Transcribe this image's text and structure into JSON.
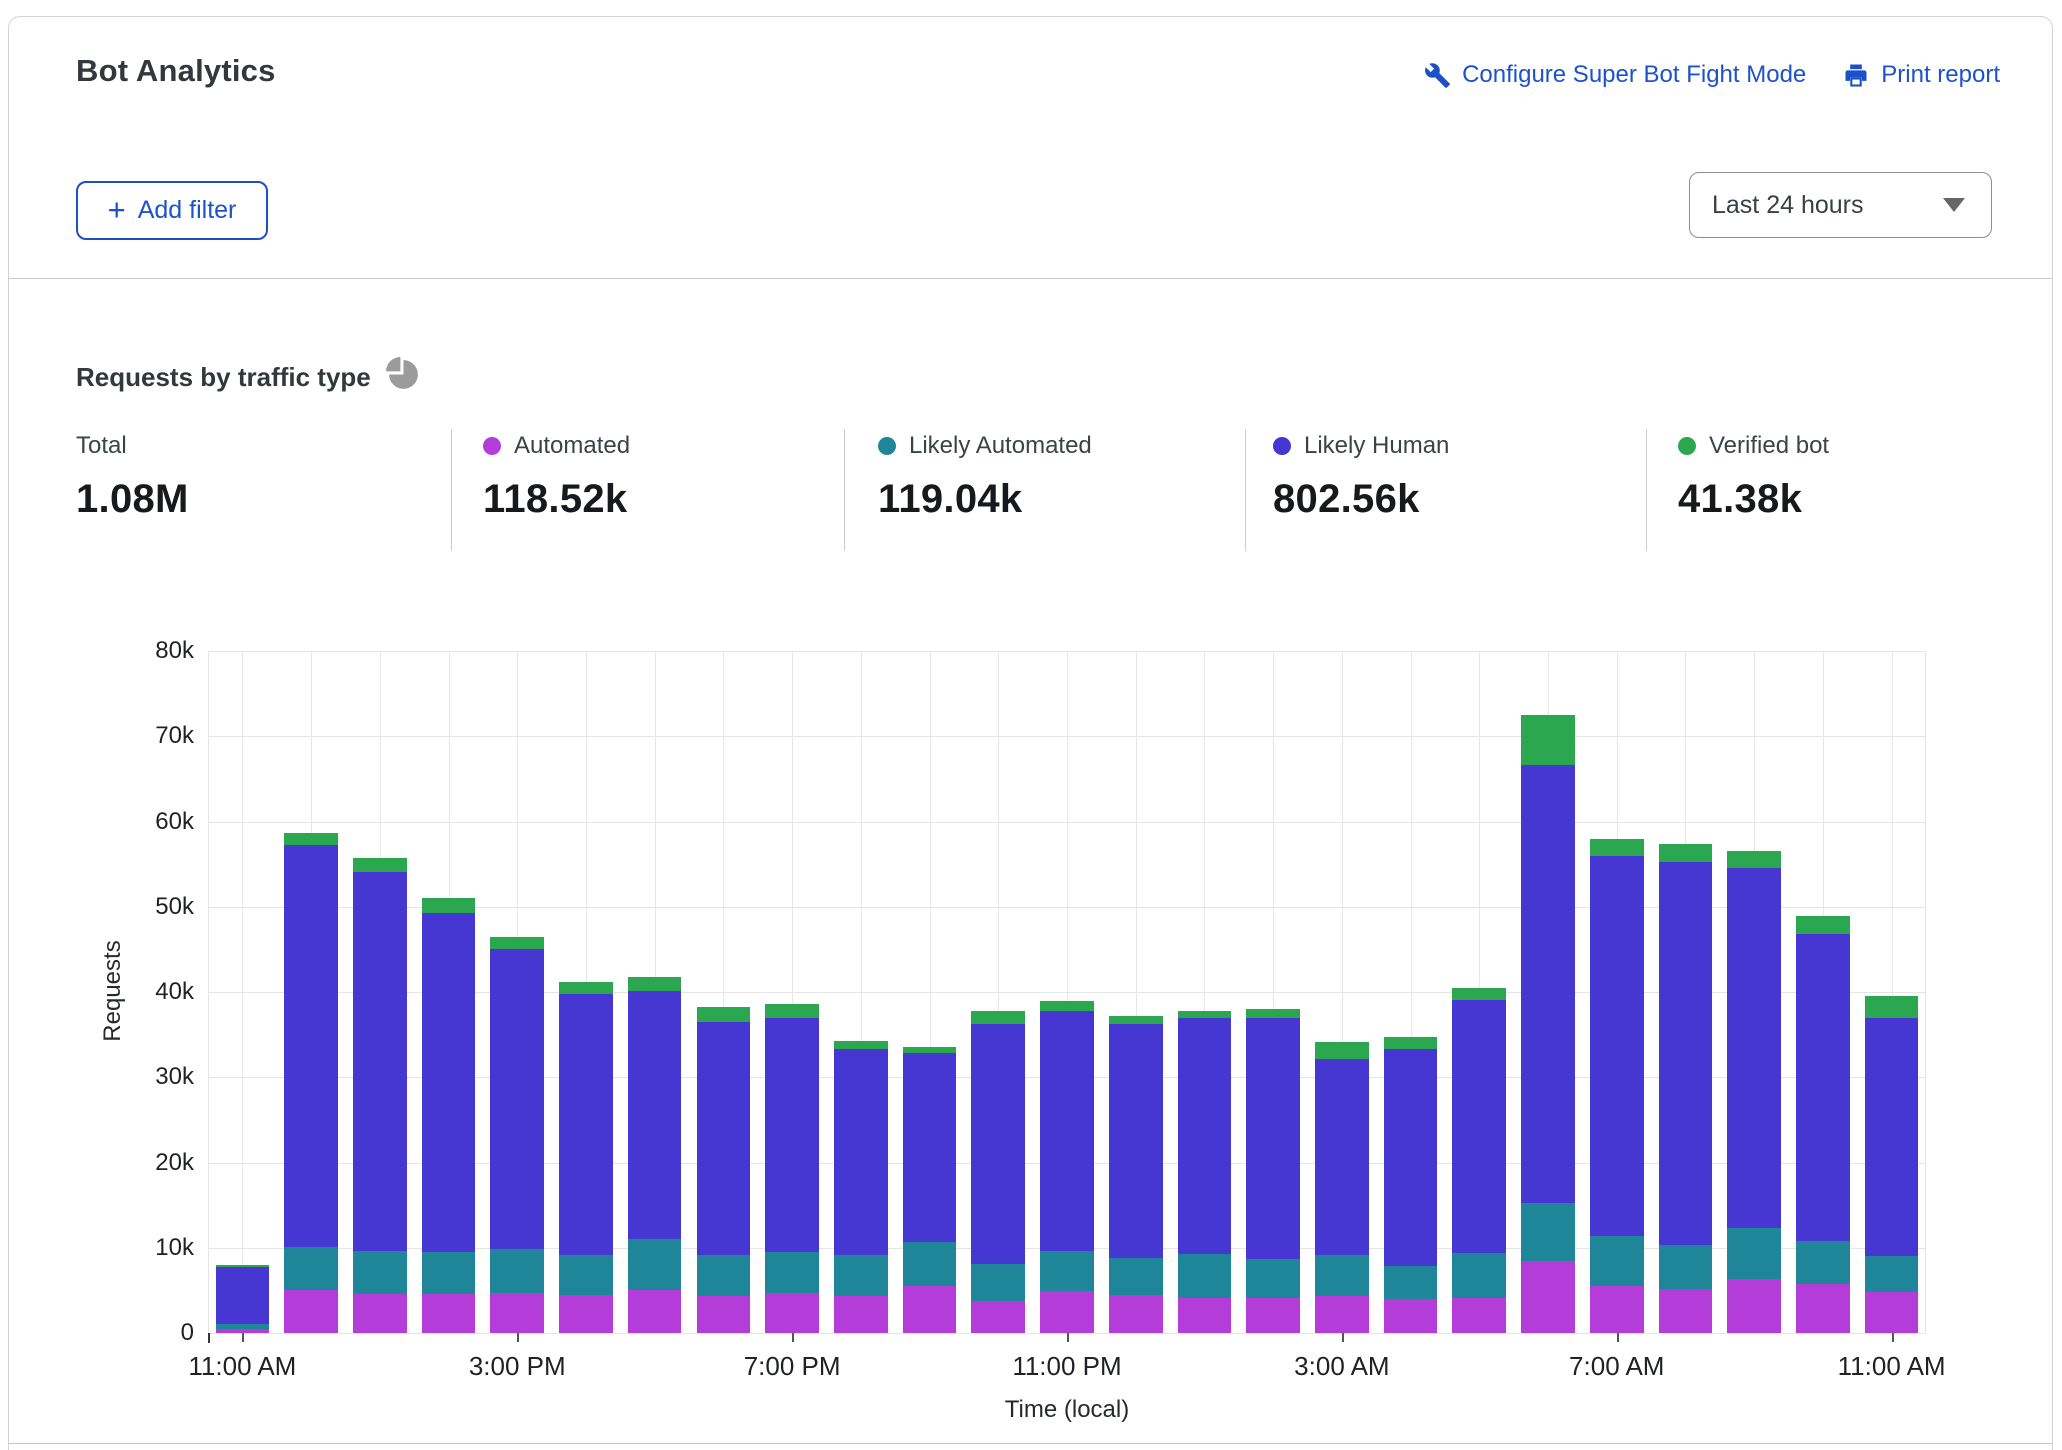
{
  "header": {
    "title": "Bot Analytics",
    "configure_link": "Configure Super Bot Fight Mode",
    "print_link": "Print report",
    "add_filter_plus": "+",
    "add_filter_label": "Add filter",
    "time_range_value": "Last 24 hours"
  },
  "section": {
    "title": "Requests by traffic type"
  },
  "stats": [
    {
      "label": "Total",
      "value": "1.08M",
      "dot": null
    },
    {
      "label": "Automated",
      "value": "118.52k",
      "dot": "#b43cd8"
    },
    {
      "label": "Likely Automated",
      "value": "119.04k",
      "dot": "#1f8598"
    },
    {
      "label": "Likely Human",
      "value": "802.56k",
      "dot": "#4637d3"
    },
    {
      "label": "Verified bot",
      "value": "41.38k",
      "dot": "#2ba84f"
    }
  ],
  "chart_data": {
    "type": "bar",
    "stacked": true,
    "title": "Requests by traffic type",
    "xlabel": "Time (local)",
    "ylabel": "Requests",
    "ylim": [
      0,
      80000
    ],
    "grid": true,
    "legend_position": "above-chart",
    "series_order": [
      "automated",
      "likely_automated",
      "likely_human",
      "verified_bot"
    ],
    "series_labels": {
      "automated": "Automated",
      "likely_automated": "Likely Automated",
      "likely_human": "Likely Human",
      "verified_bot": "Verified bot"
    },
    "colors": {
      "automated": "#b43cd8",
      "likely_automated": "#1f8598",
      "likely_human": "#4637d3",
      "verified_bot": "#2ba84f"
    },
    "y_ticks": [
      {
        "value": 0,
        "label": "0"
      },
      {
        "value": 10000,
        "label": "10k"
      },
      {
        "value": 20000,
        "label": "20k"
      },
      {
        "value": 30000,
        "label": "30k"
      },
      {
        "value": 40000,
        "label": "40k"
      },
      {
        "value": 50000,
        "label": "50k"
      },
      {
        "value": 60000,
        "label": "60k"
      },
      {
        "value": 70000,
        "label": "70k"
      },
      {
        "value": 80000,
        "label": "80k"
      }
    ],
    "x_ticks": [
      {
        "slot": 0,
        "label": "11:00 AM"
      },
      {
        "slot": 4,
        "label": "3:00 PM"
      },
      {
        "slot": 8,
        "label": "7:00 PM"
      },
      {
        "slot": 12,
        "label": "11:00 PM"
      },
      {
        "slot": 16,
        "label": "3:00 AM"
      },
      {
        "slot": 20,
        "label": "7:00 AM"
      },
      {
        "slot": 24,
        "label": "11:00 AM"
      }
    ],
    "bars": [
      {
        "time": "11:00 AM",
        "automated": 500,
        "likely_automated": 600,
        "likely_human": 6600,
        "verified_bot": 300
      },
      {
        "time": "12:00 PM",
        "automated": 5100,
        "likely_automated": 5000,
        "likely_human": 47200,
        "verified_bot": 1300
      },
      {
        "time": "1:00 PM",
        "automated": 4600,
        "likely_automated": 5000,
        "likely_human": 44500,
        "verified_bot": 1600
      },
      {
        "time": "2:00 PM",
        "automated": 4600,
        "likely_automated": 4900,
        "likely_human": 39800,
        "verified_bot": 1700
      },
      {
        "time": "3:00 PM",
        "automated": 4700,
        "likely_automated": 5100,
        "likely_human": 35200,
        "verified_bot": 1400
      },
      {
        "time": "4:00 PM",
        "automated": 4500,
        "likely_automated": 4700,
        "likely_human": 30600,
        "verified_bot": 1400
      },
      {
        "time": "5:00 PM",
        "automated": 5000,
        "likely_automated": 6000,
        "likely_human": 29100,
        "verified_bot": 1700
      },
      {
        "time": "6:00 PM",
        "automated": 4300,
        "likely_automated": 4900,
        "likely_human": 27300,
        "verified_bot": 1700
      },
      {
        "time": "7:00 PM",
        "automated": 4700,
        "likely_automated": 4800,
        "likely_human": 27500,
        "verified_bot": 1600
      },
      {
        "time": "8:00 PM",
        "automated": 4400,
        "likely_automated": 4700,
        "likely_human": 24200,
        "verified_bot": 1000
      },
      {
        "time": "9:00 PM",
        "automated": 5500,
        "likely_automated": 5200,
        "likely_human": 22100,
        "verified_bot": 700
      },
      {
        "time": "10:00 PM",
        "automated": 3800,
        "likely_automated": 4300,
        "likely_human": 28100,
        "verified_bot": 1600
      },
      {
        "time": "11:00 PM",
        "automated": 4900,
        "likely_automated": 4700,
        "likely_human": 28200,
        "verified_bot": 1200
      },
      {
        "time": "12:00 AM",
        "automated": 4500,
        "likely_automated": 4300,
        "likely_human": 27400,
        "verified_bot": 1000
      },
      {
        "time": "1:00 AM",
        "automated": 4100,
        "likely_automated": 5200,
        "likely_human": 27700,
        "verified_bot": 800
      },
      {
        "time": "2:00 AM",
        "automated": 4100,
        "likely_automated": 4600,
        "likely_human": 28300,
        "verified_bot": 1000
      },
      {
        "time": "3:00 AM",
        "automated": 4300,
        "likely_automated": 4900,
        "likely_human": 23000,
        "verified_bot": 1900
      },
      {
        "time": "4:00 AM",
        "automated": 4000,
        "likely_automated": 3900,
        "likely_human": 25400,
        "verified_bot": 1400
      },
      {
        "time": "5:00 AM",
        "automated": 4100,
        "likely_automated": 5300,
        "likely_human": 29700,
        "verified_bot": 1400
      },
      {
        "time": "6:00 AM",
        "automated": 8500,
        "likely_automated": 6800,
        "likely_human": 51300,
        "verified_bot": 5900
      },
      {
        "time": "7:00 AM",
        "automated": 5500,
        "likely_automated": 5900,
        "likely_human": 44600,
        "verified_bot": 1900
      },
      {
        "time": "8:00 AM",
        "automated": 5200,
        "likely_automated": 5100,
        "likely_human": 44900,
        "verified_bot": 2200
      },
      {
        "time": "9:00 AM",
        "automated": 6300,
        "likely_automated": 6000,
        "likely_human": 42300,
        "verified_bot": 1900
      },
      {
        "time": "10:00 AM",
        "automated": 5700,
        "likely_automated": 5100,
        "likely_human": 36000,
        "verified_bot": 2100
      },
      {
        "time": "11:00 AM",
        "automated": 4800,
        "likely_automated": 4200,
        "likely_human": 28000,
        "verified_bot": 2500
      }
    ]
  }
}
